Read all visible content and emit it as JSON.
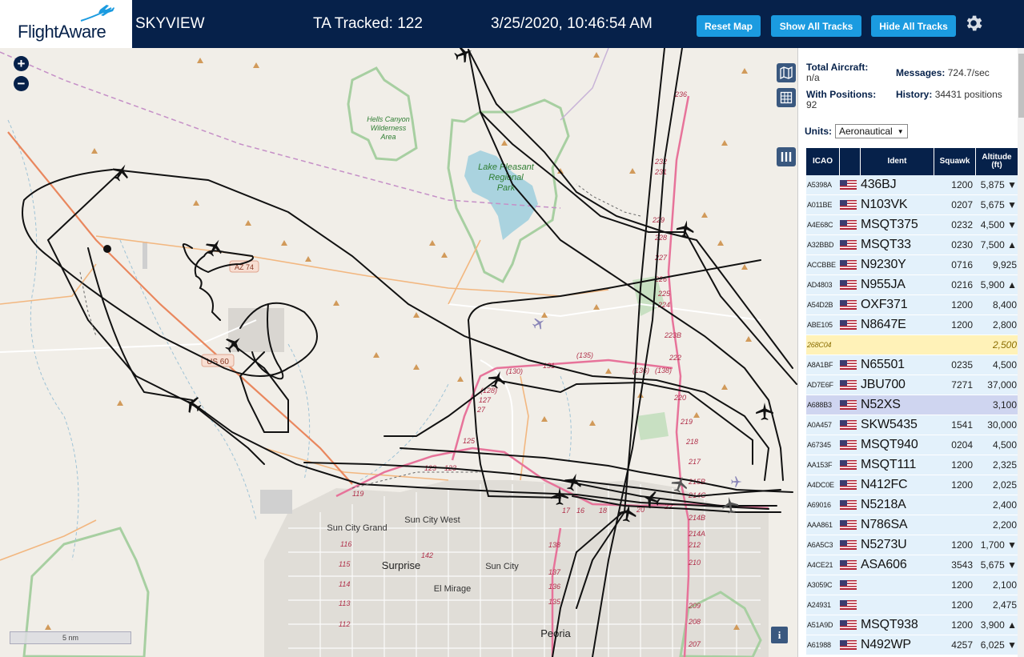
{
  "header": {
    "brand": "FlightAware",
    "app_title": "SKYVIEW",
    "ta_tracked": "TA Tracked: 122",
    "datetime": "3/25/2020, 10:46:54 AM",
    "reset_btn": "Reset Map",
    "show_btn": "Show All Tracks",
    "hide_btn": "Hide All Tracks"
  },
  "stats": {
    "total_label": "Total Aircraft:",
    "total_value": "n/a",
    "positions_label": "With Positions:",
    "positions_value": "92",
    "messages_label": "Messages:",
    "messages_value": "724.7/sec",
    "history_label": "History:",
    "history_value": "34431 positions"
  },
  "units": {
    "label": "Units:",
    "value": "Aeronautical"
  },
  "table": {
    "headers": {
      "icao": "ICAO",
      "ident": "Ident",
      "squawk": "Squawk",
      "altitude": "Altitude (ft)"
    },
    "rows": [
      {
        "icao": "A5398A",
        "ident": "436BJ",
        "squawk": "1200",
        "alt": "5,875 ▼"
      },
      {
        "icao": "A011BE",
        "ident": "N103VK",
        "squawk": "0207",
        "alt": "5,675 ▼"
      },
      {
        "icao": "A4E68C",
        "ident": "MSQT375",
        "squawk": "0232",
        "alt": "4,500 ▼"
      },
      {
        "icao": "A32BBD",
        "ident": "MSQT33",
        "squawk": "0230",
        "alt": "7,500 ▲"
      },
      {
        "icao": "ACCBBE",
        "ident": "N9230Y",
        "squawk": "0716",
        "alt": "9,925"
      },
      {
        "icao": "AD4803",
        "ident": "N955JA",
        "squawk": "0216",
        "alt": "5,900 ▲"
      },
      {
        "icao": "A54D2B",
        "ident": "OXF371",
        "squawk": "1200",
        "alt": "8,400"
      },
      {
        "icao": "ABE105",
        "ident": "N8647E",
        "squawk": "1200",
        "alt": "2,800"
      },
      {
        "icao": "268C04",
        "ident": "",
        "squawk": "",
        "alt": "2,500"
      },
      {
        "icao": "A8A1BF",
        "ident": "N65501",
        "squawk": "0235",
        "alt": "4,500"
      },
      {
        "icao": "AD7E6F",
        "ident": "JBU700",
        "squawk": "7271",
        "alt": "37,000"
      },
      {
        "icao": "A688B3",
        "ident": "N52XS",
        "squawk": "",
        "alt": "3,100"
      },
      {
        "icao": "A0A457",
        "ident": "SKW5435",
        "squawk": "1541",
        "alt": "30,000"
      },
      {
        "icao": "A67345",
        "ident": "MSQT940",
        "squawk": "0204",
        "alt": "4,500"
      },
      {
        "icao": "AA153F",
        "ident": "MSQT111",
        "squawk": "1200",
        "alt": "2,325"
      },
      {
        "icao": "A4DC0E",
        "ident": "N412FC",
        "squawk": "1200",
        "alt": "2,025"
      },
      {
        "icao": "A69016",
        "ident": "N5218A",
        "squawk": "",
        "alt": "2,400"
      },
      {
        "icao": "AAA861",
        "ident": "N786SA",
        "squawk": "",
        "alt": "2,200"
      },
      {
        "icao": "A6A5C3",
        "ident": "N5273U",
        "squawk": "1200",
        "alt": "1,700 ▼"
      },
      {
        "icao": "A4CE21",
        "ident": "ASA606",
        "squawk": "3543",
        "alt": "5,675 ▼"
      },
      {
        "icao": "A3059C",
        "ident": "",
        "squawk": "1200",
        "alt": "2,100"
      },
      {
        "icao": "A24931",
        "ident": "",
        "squawk": "1200",
        "alt": "2,475"
      },
      {
        "icao": "A51A9D",
        "ident": "MSQT938",
        "squawk": "1200",
        "alt": "3,900 ▲"
      },
      {
        "icao": "A61988",
        "ident": "N492WP",
        "squawk": "4257",
        "alt": "6,025 ▼"
      }
    ]
  },
  "map": {
    "scale": "5 nm",
    "labels": {
      "hells_canyon": "Hells Canyon Wilderness Area",
      "lake_pleasant": "Lake Pleasant Regional Park",
      "az74": "AZ 74",
      "us60": "US 60",
      "sun_city_grand": "Sun City Grand",
      "sun_city_west": "Sun City West",
      "surprise": "Surprise",
      "sun_city": "Sun City",
      "el_mirage": "El Mirage",
      "peoria": "Peoria"
    }
  }
}
